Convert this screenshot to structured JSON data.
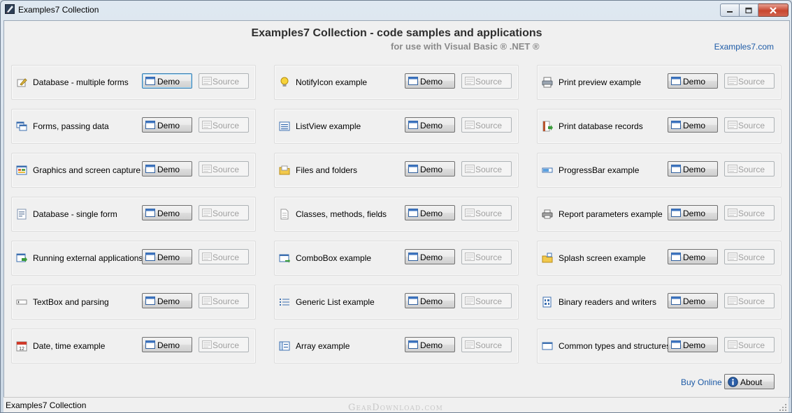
{
  "window": {
    "title": "Examples7 Collection"
  },
  "header": {
    "title": "Examples7 Collection - code samples and applications",
    "subtitle": "for use with Visual Basic ® .NET ®",
    "site_link": "Examples7.com"
  },
  "buttons": {
    "demo": "Demo",
    "source": "Source"
  },
  "examples": [
    [
      {
        "label": "Database - multiple forms",
        "icon": "edit-form-icon"
      },
      {
        "label": "Forms, passing data",
        "icon": "windows-icon"
      },
      {
        "label": "Graphics and screen capture",
        "icon": "graphics-icon"
      },
      {
        "label": "Database - single form",
        "icon": "form-icon"
      },
      {
        "label": "Running external applications",
        "icon": "run-app-icon"
      },
      {
        "label": "TextBox and parsing",
        "icon": "textbox-icon"
      },
      {
        "label": "Date, time example",
        "icon": "calendar-icon"
      }
    ],
    [
      {
        "label": "NotifyIcon example",
        "icon": "lightbulb-icon"
      },
      {
        "label": "ListView example",
        "icon": "listview-icon"
      },
      {
        "label": "Files and folders",
        "icon": "folder-icon"
      },
      {
        "label": "Classes, methods, fields",
        "icon": "document-icon"
      },
      {
        "label": "ComboBox example",
        "icon": "combobox-icon"
      },
      {
        "label": "Generic List example",
        "icon": "list-icon"
      },
      {
        "label": "Array example",
        "icon": "array-icon"
      }
    ],
    [
      {
        "label": "Print preview example",
        "icon": "print-preview-icon"
      },
      {
        "label": "Print database records",
        "icon": "print-records-icon"
      },
      {
        "label": "ProgressBar example",
        "icon": "progressbar-icon"
      },
      {
        "label": "Report parameters example",
        "icon": "printer-icon"
      },
      {
        "label": "Splash screen example",
        "icon": "splash-icon"
      },
      {
        "label": "Binary readers and writers",
        "icon": "binary-icon"
      },
      {
        "label": "Common types and structures",
        "icon": "structure-icon"
      }
    ]
  ],
  "footer": {
    "buy_online": "Buy Online",
    "about": "About"
  },
  "status": {
    "text": "Examples7 Collection",
    "watermark": "GearDownload.com"
  }
}
